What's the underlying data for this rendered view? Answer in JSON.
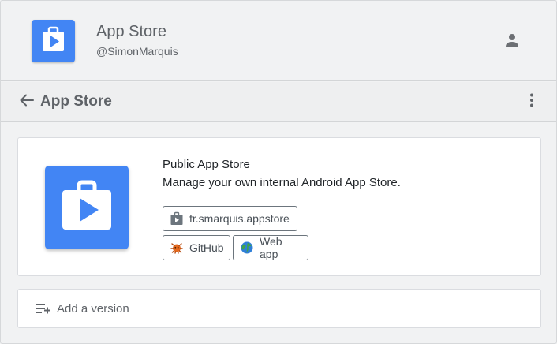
{
  "header": {
    "title": "App Store",
    "subtitle": "@SimonMarquis",
    "logo_icon": "play-store-bag-icon",
    "account_icon": "person-icon"
  },
  "toolbar": {
    "title": "App Store",
    "back_icon": "arrow-back-icon",
    "more_icon": "more-vertical-icon"
  },
  "app": {
    "name": "Public App Store",
    "description": "Manage your own internal Android App Store.",
    "icon": "play-store-bag-icon",
    "package_name": "fr.smarquis.appstore",
    "links": [
      {
        "label": "GitHub",
        "icon": "github-octocat-icon"
      },
      {
        "label": "Web app",
        "icon": "globe-icon"
      }
    ]
  },
  "actions": {
    "add_version_label": "Add a version",
    "add_version_icon": "playlist-add-icon"
  },
  "colors": {
    "brand_blue": "#4285f4",
    "background": "#f1f2f3",
    "text_muted": "#5f6368"
  }
}
